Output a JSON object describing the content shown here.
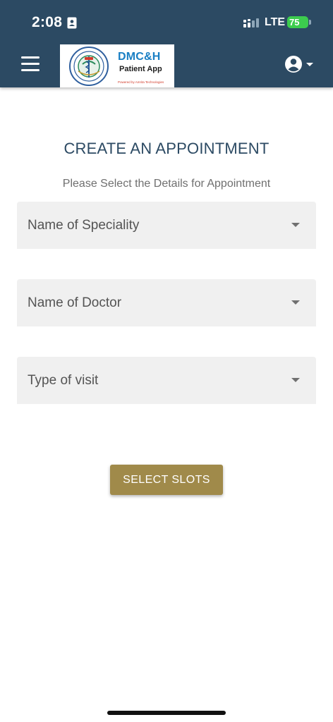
{
  "status_bar": {
    "time": "2:08",
    "network": "LTE",
    "battery": "75"
  },
  "header": {
    "logo": {
      "name": "DMC&H",
      "subtitle": "Patient App",
      "powered_by": "Powered by Amrita Technologies"
    },
    "icons": {
      "menu": "hamburger-menu-icon",
      "account": "account-circle-icon"
    }
  },
  "main": {
    "title": "CREATE AN APPOINTMENT",
    "subtitle": "Please Select the Details for Appointment",
    "fields": [
      {
        "label": "Name of Speciality"
      },
      {
        "label": "Name of Doctor"
      },
      {
        "label": "Type of visit"
      }
    ],
    "button_label": "SELECT SLOTS"
  },
  "colors": {
    "header_bg": "#2c4a63",
    "title": "#2c4a63",
    "button_bg": "#a08a4a",
    "field_bg": "#f0f0f0",
    "battery": "#3ccc4e"
  }
}
